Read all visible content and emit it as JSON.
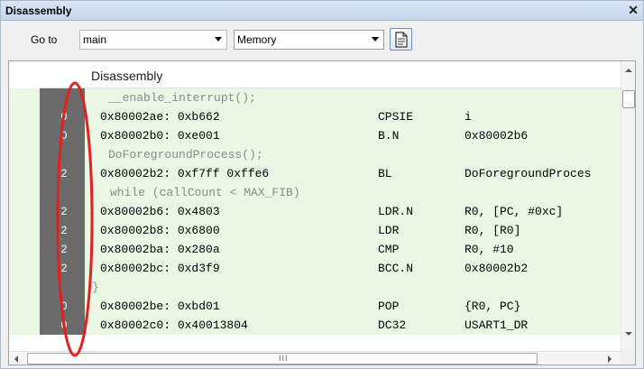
{
  "window": {
    "title": "Disassembly"
  },
  "toolbar": {
    "goto_label": "Go to",
    "goto_value": "main",
    "memory_value": "Memory"
  },
  "table": {
    "header": "Disassembly",
    "rows": [
      {
        "kind": "src",
        "count": "",
        "text": "__enable_interrupt();"
      },
      {
        "kind": "asm",
        "count": "0",
        "addr": "0x80002ae: 0xb662",
        "op": "CPSIE",
        "arg": "i"
      },
      {
        "kind": "asm",
        "count": "0",
        "addr": "0x80002b0: 0xe001",
        "op": "B.N",
        "arg": "0x80002b6"
      },
      {
        "kind": "src",
        "count": "",
        "text": "DoForegroundProcess();"
      },
      {
        "kind": "asm",
        "count": "2",
        "addr": "0x80002b2: 0xf7ff 0xffe6",
        "op": "BL",
        "arg": "DoForegroundProces"
      },
      {
        "kind": "src",
        "count": "",
        "text": "while (callCount < MAX_FIB)"
      },
      {
        "kind": "asm",
        "count": "2",
        "addr": "0x80002b6: 0x4803",
        "op": "LDR.N",
        "arg": "R0, [PC, #0xc]"
      },
      {
        "kind": "asm",
        "count": "2",
        "addr": "0x80002b8: 0x6800",
        "op": "LDR",
        "arg": "R0, [R0]"
      },
      {
        "kind": "asm",
        "count": "2",
        "addr": "0x80002ba: 0x280a",
        "op": "CMP",
        "arg": "R0, #10"
      },
      {
        "kind": "asm",
        "count": "2",
        "addr": "0x80002bc: 0xd3f9",
        "op": "BCC.N",
        "arg": "0x80002b2"
      },
      {
        "kind": "src",
        "count": "",
        "text": "}"
      },
      {
        "kind": "asm",
        "count": "0",
        "addr": "0x80002be: 0xbd01",
        "op": "POP",
        "arg": "{R0, PC}"
      },
      {
        "kind": "asm",
        "count": "0",
        "addr": "0x80002c0: 0x40013804",
        "op": "DC32",
        "arg": "USART1_DR"
      }
    ]
  },
  "scrollbar": {
    "grip": "III"
  },
  "icons": {
    "close": "close-icon",
    "dropdown": "chevron-down-icon",
    "toolbar_button": "document-icon"
  },
  "colors": {
    "row_bg": "#eaf7e4",
    "gutter_bg": "#6b6b6b",
    "annotation": "#e32020"
  }
}
